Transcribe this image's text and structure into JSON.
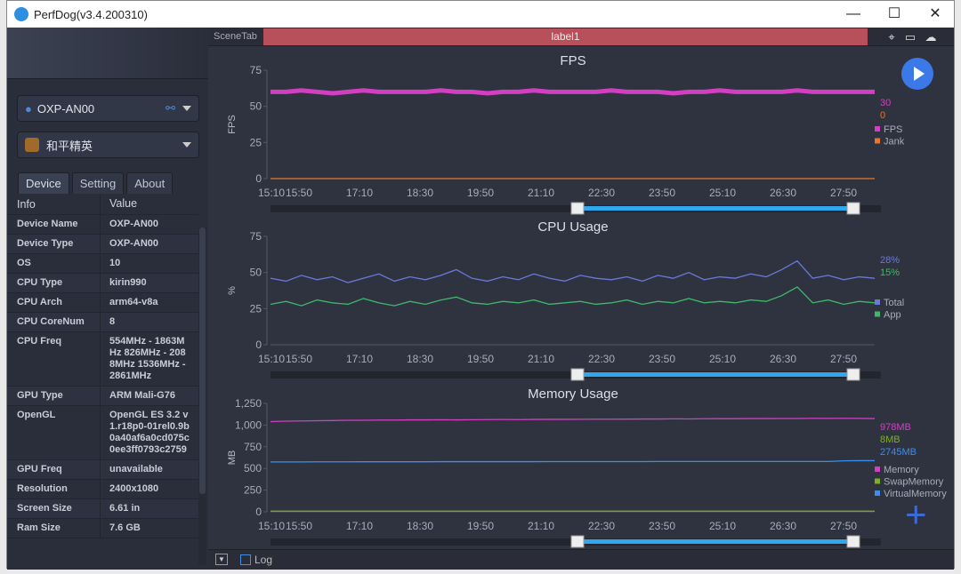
{
  "window": {
    "title": "PerfDog(v3.4.200310)",
    "controls": [
      "—",
      "☐",
      "✕"
    ]
  },
  "left": {
    "device_select": "OXP-AN00",
    "app_select": "和平精英",
    "tabs": [
      "Device",
      "Setting",
      "About"
    ],
    "table_headers": [
      "Info",
      "Value"
    ],
    "rows": [
      [
        "Device Name",
        "OXP-AN00"
      ],
      [
        "Device Type",
        "OXP-AN00"
      ],
      [
        "OS",
        "10"
      ],
      [
        "CPU Type",
        "kirin990"
      ],
      [
        "CPU Arch",
        "arm64-v8a"
      ],
      [
        "CPU CoreNum",
        "8"
      ],
      [
        "CPU Freq",
        "554MHz - 1863MHz 826MHz - 2088MHz 1536MHz - 2861MHz"
      ],
      [
        "GPU Type",
        "ARM Mali-G76"
      ],
      [
        "OpenGL",
        "OpenGL ES 3.2 v1.r18p0-01rel0.9b0a40af6a0cd075c0ee3ff0793c2759"
      ],
      [
        "GPU Freq",
        "unavailable"
      ],
      [
        "Resolution",
        "2400x1080"
      ],
      [
        "Screen Size",
        "6.61 in"
      ],
      [
        "Ram Size",
        "7.6 GB"
      ]
    ]
  },
  "scene": {
    "tab_label": "SceneTab",
    "label": "label1",
    "icons": [
      "location-icon",
      "folder-icon",
      "cloud-icon"
    ]
  },
  "bottom": {
    "log_label": "Log"
  },
  "chart_data": [
    {
      "type": "line",
      "title": "FPS",
      "ylabel": "FPS",
      "ylim": [
        0,
        75
      ],
      "yticks": [
        "0",
        "25",
        "50",
        "75"
      ],
      "xticks": [
        "15:10",
        "15:50",
        "17:10",
        "18:30",
        "19:50",
        "21:10",
        "22:30",
        "23:50",
        "25:10",
        "26:30",
        "27:50"
      ],
      "series": [
        {
          "name": "FPS",
          "color": "#d040c0",
          "current": "30",
          "values": [
            60,
            60,
            61,
            60,
            59,
            60,
            61,
            60,
            60,
            60,
            60,
            61,
            60,
            60,
            59,
            60,
            60,
            61,
            60,
            60,
            60,
            60,
            61,
            60,
            60,
            60,
            59,
            60,
            60,
            61,
            60,
            60,
            60,
            60,
            61,
            60,
            60,
            60,
            60,
            60
          ]
        },
        {
          "name": "Jank",
          "color": "#e8772e",
          "current": "0",
          "values": [
            0,
            0,
            0,
            0,
            0,
            0,
            0,
            0,
            0,
            0,
            0,
            0,
            0,
            0,
            0,
            0,
            0,
            0,
            0,
            0,
            0,
            0,
            0,
            0,
            0,
            0,
            0,
            0,
            0,
            0,
            0,
            0,
            0,
            0,
            0,
            0,
            0,
            0,
            0,
            0
          ]
        }
      ]
    },
    {
      "type": "line",
      "title": "CPU Usage",
      "ylabel": "%",
      "ylim": [
        0,
        75
      ],
      "yticks": [
        "0",
        "25",
        "50",
        "75"
      ],
      "xticks": [
        "15:10",
        "15:50",
        "17:10",
        "18:30",
        "19:50",
        "21:10",
        "22:30",
        "23:50",
        "25:10",
        "26:30",
        "27:50"
      ],
      "series": [
        {
          "name": "Total",
          "color": "#6a78d8",
          "current": "28%",
          "values": [
            46,
            44,
            48,
            45,
            47,
            43,
            46,
            49,
            44,
            47,
            45,
            48,
            52,
            46,
            44,
            47,
            45,
            49,
            46,
            44,
            48,
            46,
            45,
            47,
            44,
            48,
            46,
            50,
            45,
            47,
            46,
            49,
            47,
            52,
            58,
            46,
            48,
            45,
            47,
            46
          ]
        },
        {
          "name": "App",
          "color": "#3fb86a",
          "current": "15%",
          "values": [
            28,
            30,
            27,
            31,
            29,
            28,
            32,
            29,
            27,
            30,
            28,
            31,
            33,
            29,
            28,
            30,
            29,
            31,
            28,
            29,
            30,
            28,
            29,
            31,
            28,
            30,
            29,
            32,
            29,
            30,
            29,
            31,
            30,
            34,
            40,
            29,
            31,
            28,
            30,
            29
          ]
        }
      ]
    },
    {
      "type": "line",
      "title": "Memory Usage",
      "ylabel": "MB",
      "ylim": [
        0,
        1250
      ],
      "yticks": [
        "0",
        "250",
        "500",
        "750",
        "1,000",
        "1,250"
      ],
      "xticks": [
        "15:10",
        "15:50",
        "17:10",
        "18:30",
        "19:50",
        "21:10",
        "22:30",
        "23:50",
        "25:10",
        "26:30",
        "27:50"
      ],
      "series": [
        {
          "name": "Memory",
          "color": "#d040c0",
          "current": "978MB",
          "values": [
            1040,
            1045,
            1048,
            1050,
            1052,
            1055,
            1055,
            1058,
            1058,
            1060,
            1060,
            1062,
            1060,
            1062,
            1063,
            1064,
            1063,
            1065,
            1066,
            1066,
            1067,
            1068,
            1068,
            1069,
            1070,
            1070,
            1072,
            1071,
            1073,
            1074,
            1074,
            1075,
            1075,
            1076,
            1076,
            1078,
            1077,
            1078,
            1077,
            1075
          ]
        },
        {
          "name": "SwapMemory",
          "color": "#7fb020",
          "current": "8MB",
          "values": [
            8,
            8,
            8,
            8,
            8,
            8,
            8,
            8,
            8,
            8,
            8,
            8,
            8,
            8,
            8,
            8,
            8,
            8,
            8,
            8,
            8,
            8,
            8,
            8,
            8,
            8,
            8,
            8,
            8,
            8,
            8,
            8,
            8,
            8,
            8,
            8,
            8,
            8,
            8,
            8
          ]
        },
        {
          "name": "VirtualMemory",
          "color": "#3b8ef0",
          "current": "2745MB",
          "values": [
            575,
            575,
            575,
            576,
            576,
            576,
            577,
            577,
            577,
            577,
            577,
            578,
            578,
            578,
            578,
            578,
            578,
            578,
            579,
            579,
            579,
            579,
            579,
            579,
            579,
            580,
            580,
            580,
            580,
            580,
            580,
            580,
            580,
            580,
            580,
            580,
            580,
            588,
            590,
            590
          ]
        }
      ]
    }
  ]
}
